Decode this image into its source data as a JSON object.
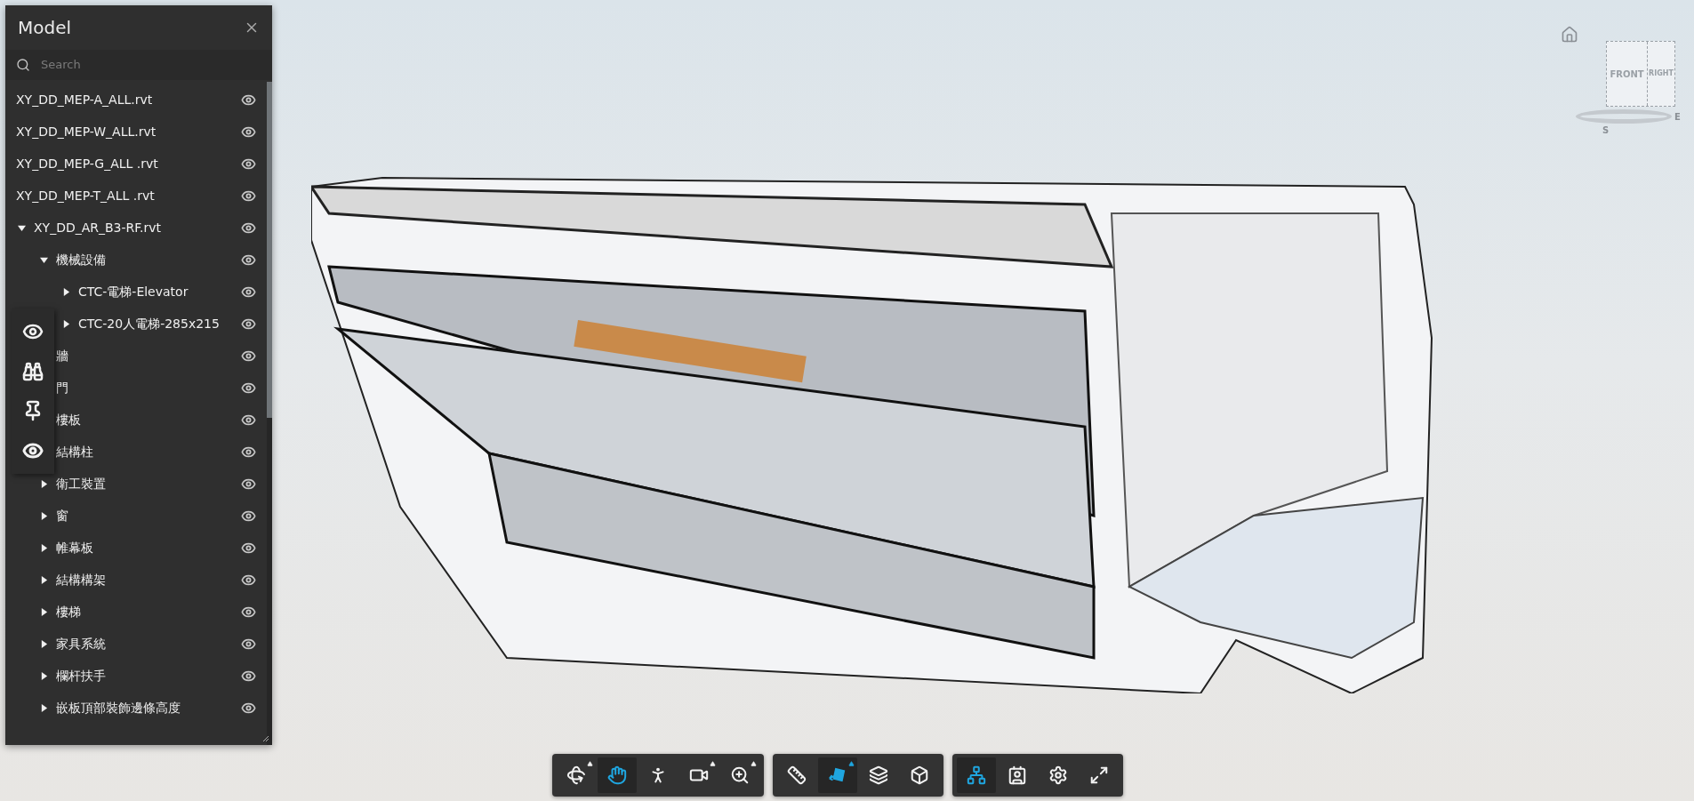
{
  "panel": {
    "title": "Model",
    "search": {
      "placeholder": "Search"
    },
    "tree": [
      {
        "label": "XY_DD_MEP-A_ALL.rvt",
        "visible": true
      },
      {
        "label": "XY_DD_MEP-W_ALL.rvt",
        "visible": true
      },
      {
        "label": "XY_DD_MEP-G_ALL .rvt",
        "visible": true
      },
      {
        "label": "XY_DD_MEP-T_ALL .rvt",
        "visible": true
      },
      {
        "label": "XY_DD_AR_B3-RF.rvt",
        "visible": true,
        "expanded": true,
        "children": [
          {
            "label": "機械設備",
            "visible": true,
            "expanded": true,
            "children": [
              {
                "label": "CTC-電梯-Elevator",
                "visible": true,
                "expanded": false
              },
              {
                "label": "CTC-20人電梯-285x215",
                "visible": true,
                "expanded": false
              }
            ]
          },
          {
            "label": "牆",
            "visible": true
          },
          {
            "label": "門",
            "visible": true
          },
          {
            "label": "樓板",
            "visible": true
          },
          {
            "label": "結構柱",
            "visible": true
          },
          {
            "label": "衛工裝置",
            "visible": true,
            "expanded": false
          },
          {
            "label": "窗",
            "visible": true,
            "expanded": false
          },
          {
            "label": "帷幕板",
            "visible": true,
            "expanded": false
          },
          {
            "label": "結構構架",
            "visible": true,
            "expanded": false
          },
          {
            "label": "樓梯",
            "visible": true,
            "expanded": false
          },
          {
            "label": "家具系統",
            "visible": true,
            "expanded": false
          },
          {
            "label": "欄杆扶手",
            "visible": true,
            "expanded": false
          },
          {
            "label": "嵌板頂部裝飾邊條高度",
            "visible": true,
            "expanded": false
          }
        ]
      }
    ]
  },
  "side_tools": [
    {
      "kind": "eye"
    },
    {
      "kind": "binoculars"
    },
    {
      "kind": "pin"
    },
    {
      "kind": "eye-pupil"
    }
  ],
  "toolbar": {
    "groups": [
      {
        "buttons": [
          {
            "kind": "orbit",
            "selected": false,
            "has_menu": true
          },
          {
            "kind": "pan",
            "selected": true,
            "has_menu": false
          },
          {
            "kind": "walk",
            "selected": false,
            "has_menu": false
          },
          {
            "kind": "camera",
            "selected": false,
            "has_menu": true
          },
          {
            "kind": "fit",
            "selected": false,
            "has_menu": true
          }
        ]
      },
      {
        "buttons": [
          {
            "kind": "measure",
            "selected": false,
            "has_menu": false
          },
          {
            "kind": "section",
            "selected": true,
            "has_menu": true
          },
          {
            "kind": "layers",
            "selected": false,
            "has_menu": false
          },
          {
            "kind": "explode",
            "selected": false,
            "has_menu": false
          }
        ]
      },
      {
        "buttons": [
          {
            "kind": "browser",
            "selected": true,
            "has_menu": false
          },
          {
            "kind": "properties",
            "selected": false,
            "has_menu": false
          },
          {
            "kind": "settings",
            "selected": false,
            "has_menu": false
          },
          {
            "kind": "fullscreen",
            "selected": false,
            "has_menu": false
          }
        ]
      }
    ]
  },
  "view_cube": {
    "faces": [
      "FRONT",
      "RIGHT"
    ],
    "compass": [
      "S",
      "E"
    ]
  }
}
